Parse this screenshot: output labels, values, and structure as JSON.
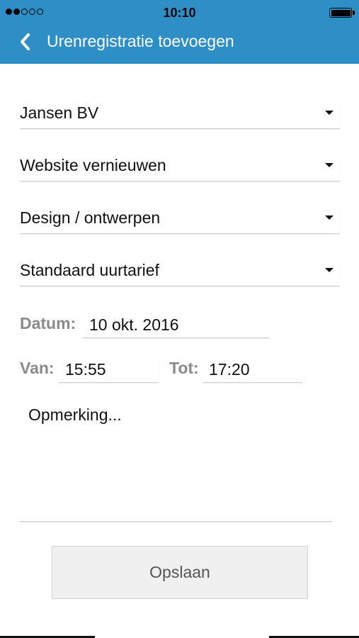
{
  "status_bar": {
    "time": "10:10",
    "signal_bars_filled": 2,
    "signal_bars_total": 5,
    "battery_level": 1.0
  },
  "nav": {
    "title": "Urenregistratie toevoegen",
    "back_icon": "chevron-left-icon"
  },
  "form": {
    "client": "Jansen BV",
    "project": "Website vernieuwen",
    "activity": "Design / ontwerpen",
    "rate": "Standaard uurtarief",
    "date_label": "Datum:",
    "date_value": "10 okt. 2016",
    "from_label": "Van:",
    "from_value": "15:55",
    "to_label": "Tot:",
    "to_value": "17:20",
    "remark_placeholder": "Opmerking...",
    "save_label": "Opslaan"
  },
  "colors": {
    "nav_background": "#2e8fc7",
    "label_gray": "#8a8a8a",
    "button_background": "#f0f0f0"
  }
}
